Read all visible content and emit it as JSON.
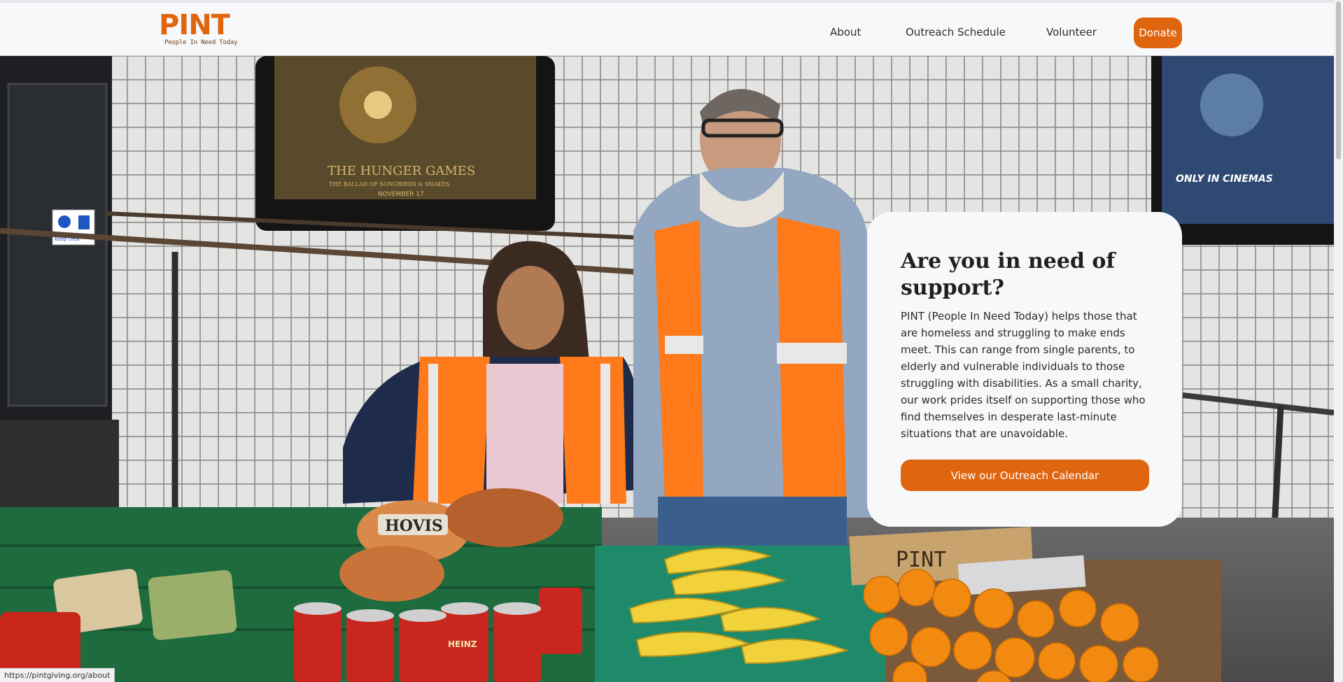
{
  "header": {
    "logo_word": "PINT",
    "logo_tagline": "People In Need Today",
    "nav": [
      {
        "label": "About"
      },
      {
        "label": "Outreach Schedule"
      },
      {
        "label": "Volunteer"
      }
    ],
    "donate_label": "Donate"
  },
  "hero": {
    "poster_left_title": "THE HUNGER GAMES",
    "poster_left_subtitle": "THE BALLAD OF SONGBIRDS & SNAKES",
    "poster_left_date": "NOVEMBER 17",
    "poster_right_text": "ONLY IN CINEMAS",
    "sign_text": "Keep clear",
    "bread_brand": "HOVIS",
    "can_brand": "HEINZ",
    "cardboard_text": "PINT"
  },
  "card": {
    "title": "Are you in need of support?",
    "body": "PINT (People In Need Today) helps those that are homeless and struggling to make ends meet. This can range from single parents, to elderly and vulnerable individuals to those struggling with disabilities. As a small charity, our work prides itself on supporting those who find themselves in desperate last-minute situations that are unavoidable.",
    "button_label": "View our Outreach Calendar"
  },
  "status_bar": {
    "url": "https://pintgiving.org/about"
  },
  "colors": {
    "accent": "#e0650f",
    "header_bg": "#f7f8fa",
    "card_bg": "#f7f8fa",
    "text_dark": "#1f1f1f"
  }
}
